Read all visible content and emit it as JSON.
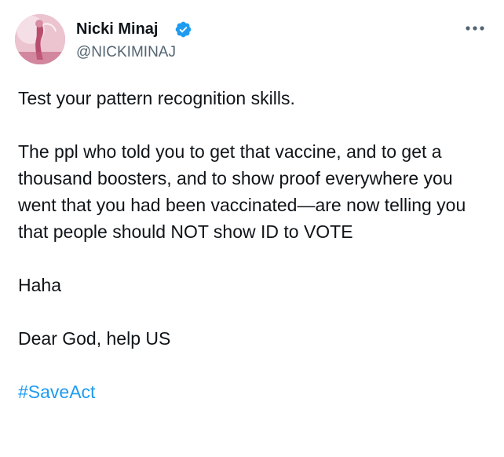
{
  "author": {
    "name": "Nicki Minaj",
    "handle": "@NICKIMINAJ",
    "verified": true,
    "verified_color": "#1d9bf0"
  },
  "menu": {
    "icon": "more-horizontal-icon"
  },
  "tweet": {
    "paragraphs": [
      "Test your pattern recognition skills.",
      "The ppl who told you to get that vaccine, and to get a thousand boosters, and to show proof everywhere you went that you had been vaccinated—are now telling you that people should NOT show ID to VOTE",
      "Haha",
      "Dear God, help US"
    ],
    "hashtag": "#SaveAct"
  },
  "colors": {
    "text": "#0f1419",
    "secondary": "#536471",
    "link": "#1d9bf0"
  }
}
